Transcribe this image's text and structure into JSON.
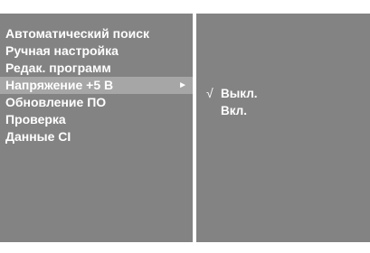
{
  "menu": {
    "items": [
      {
        "label": "Автоматический поиск"
      },
      {
        "label": "Ручная настройка"
      },
      {
        "label": "Редак. программ"
      },
      {
        "label": "Напряжение +5 В"
      },
      {
        "label": "Обновление ПО"
      },
      {
        "label": "Проверка"
      },
      {
        "label": "Данные CI"
      }
    ],
    "selected_index": 3,
    "submenu_arrow_icon": "triangle-right-icon"
  },
  "submenu": {
    "options": [
      {
        "label": "Выкл."
      },
      {
        "label": "Вкл."
      }
    ],
    "checkmark": "√",
    "checked_index": 0
  },
  "colors": {
    "panel": "#838383",
    "highlight": "#a6a6a6",
    "text": "#ffffff",
    "background": "#ffffff"
  }
}
